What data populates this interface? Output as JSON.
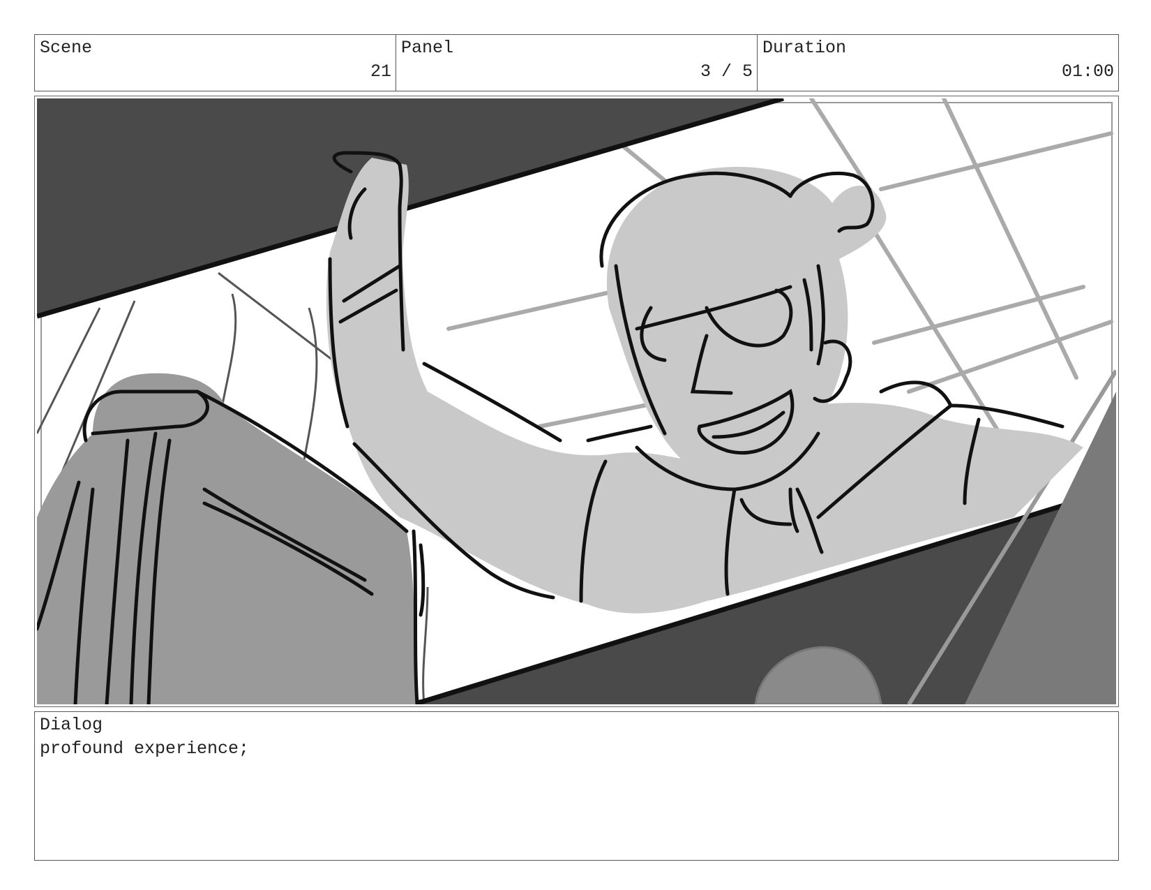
{
  "header": {
    "scene": {
      "label": "Scene",
      "value": "21"
    },
    "panel": {
      "label": "Panel",
      "value": "3 / 5"
    },
    "duration": {
      "label": "Duration",
      "value": "01:00"
    }
  },
  "dialog": {
    "label": "Dialog",
    "text": "profound experience;"
  },
  "colors": {
    "dark_gray": "#4a4a4a",
    "mid_gray": "#9a9a9a",
    "light_gray": "#c9c9c9",
    "line": "#111111",
    "grid_line": "#aaaaaa"
  }
}
